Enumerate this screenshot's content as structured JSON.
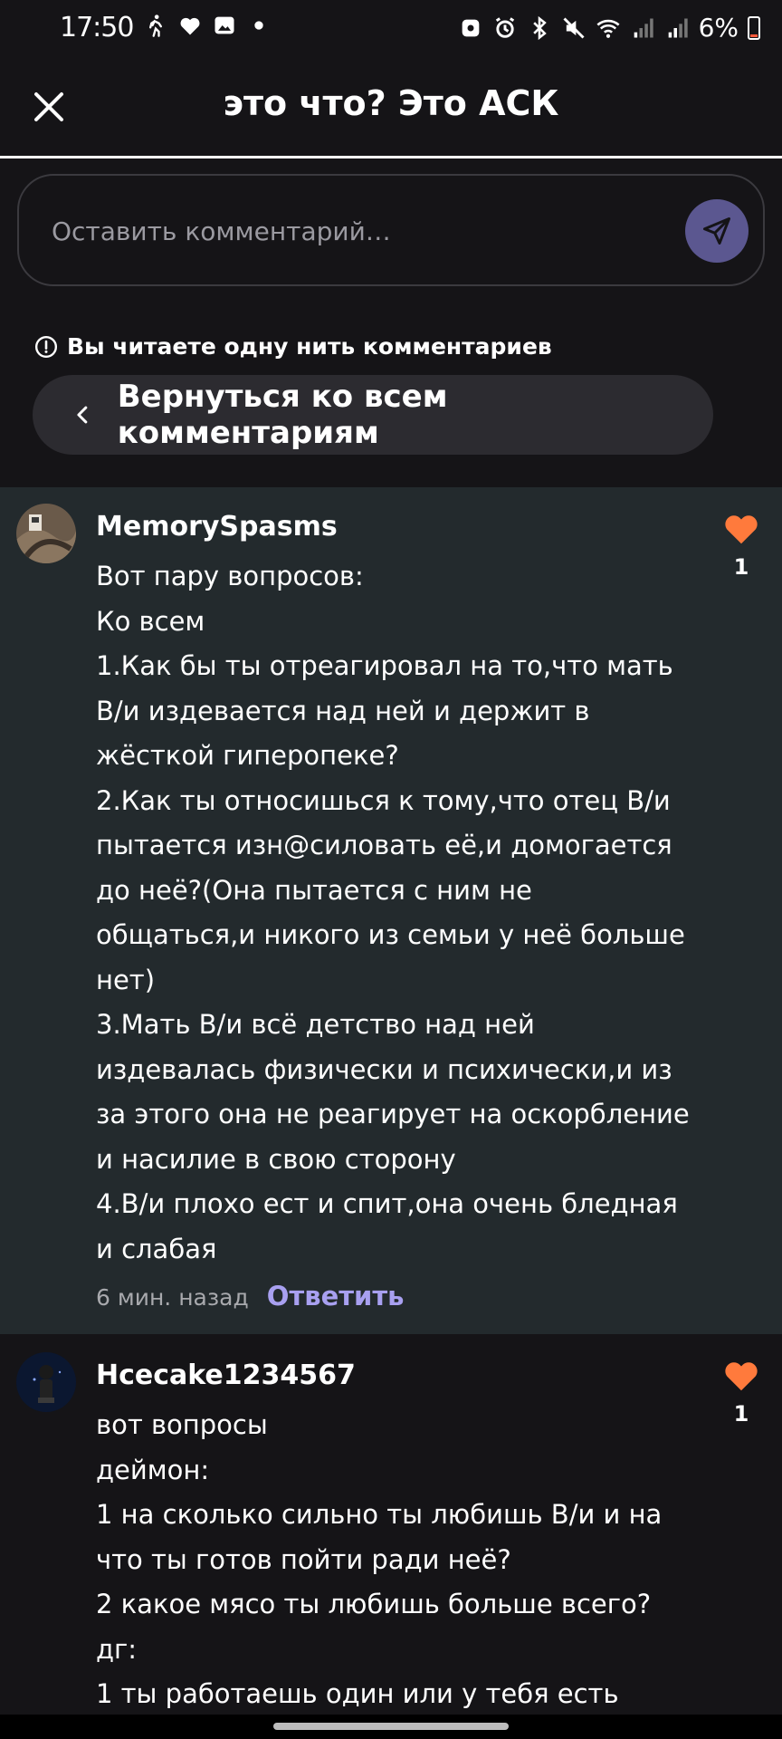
{
  "status_bar": {
    "time": "17:50",
    "battery": "6%",
    "left_icons": [
      "walk-icon",
      "heart-badge-icon",
      "image-icon",
      "dot-icon"
    ],
    "right_icons": [
      "vpn-icon",
      "alarm-icon",
      "bluetooth-icon",
      "mute-icon",
      "wifi-icon",
      "signal-icon",
      "signal-icon",
      "battery-icon"
    ],
    "battery_color": "#ff5a3c"
  },
  "header": {
    "title": "это что? Это АСК",
    "close_icon": "close-icon"
  },
  "comment_input": {
    "placeholder": "Оставить комментарий…",
    "send_icon": "send-icon",
    "send_color": "#5b5790"
  },
  "thread": {
    "note": "Вы читаете одну нить комментариев",
    "back_label": "Вернуться ко всем комментариям"
  },
  "comments": [
    {
      "username": "MemorySpasms",
      "lines": [
        "Вот пару вопросов:",
        "Ко всем",
        "1.Как бы ты отреагировал на то,что мать",
        "В/и издевается над ней и держит в",
        "жёсткой гиперопеке?",
        "2.Как ты относишься к тому,что отец В/и",
        "пытается изн@силовать её,и домогается",
        "до неё?(Она пытается с ним не",
        "общаться,и никого из семьи у неё больше",
        "нет)",
        "3.Мать В/и всё детство над ней",
        "издевалась физически и психически,и из",
        "за этого она не реагирует на оскорбление",
        "и насилие в свою сторону",
        "4.В/и плохо ест и спит,она очень бледная",
        "и слабая"
      ],
      "time": "6 мин. назад",
      "reply_label": "Ответить",
      "likes": "1",
      "highlighted": true
    },
    {
      "username": "Hcecake1234567",
      "lines": [
        "вот вопросы",
        "деймон:",
        "1 на сколько сильно ты любишь В/и и на",
        "что ты готов пойти ради неё?",
        "2 какое мясо ты любишь больше всего?",
        "дг:",
        "1 ты работаешь один или у тебя есть"
      ],
      "likes": "1",
      "highlighted": false
    }
  ],
  "colors": {
    "background": "#151417",
    "highlight_bg": "#232a2d",
    "like_heart": "#ff7a3c",
    "reply_link": "#a8a0f0"
  }
}
